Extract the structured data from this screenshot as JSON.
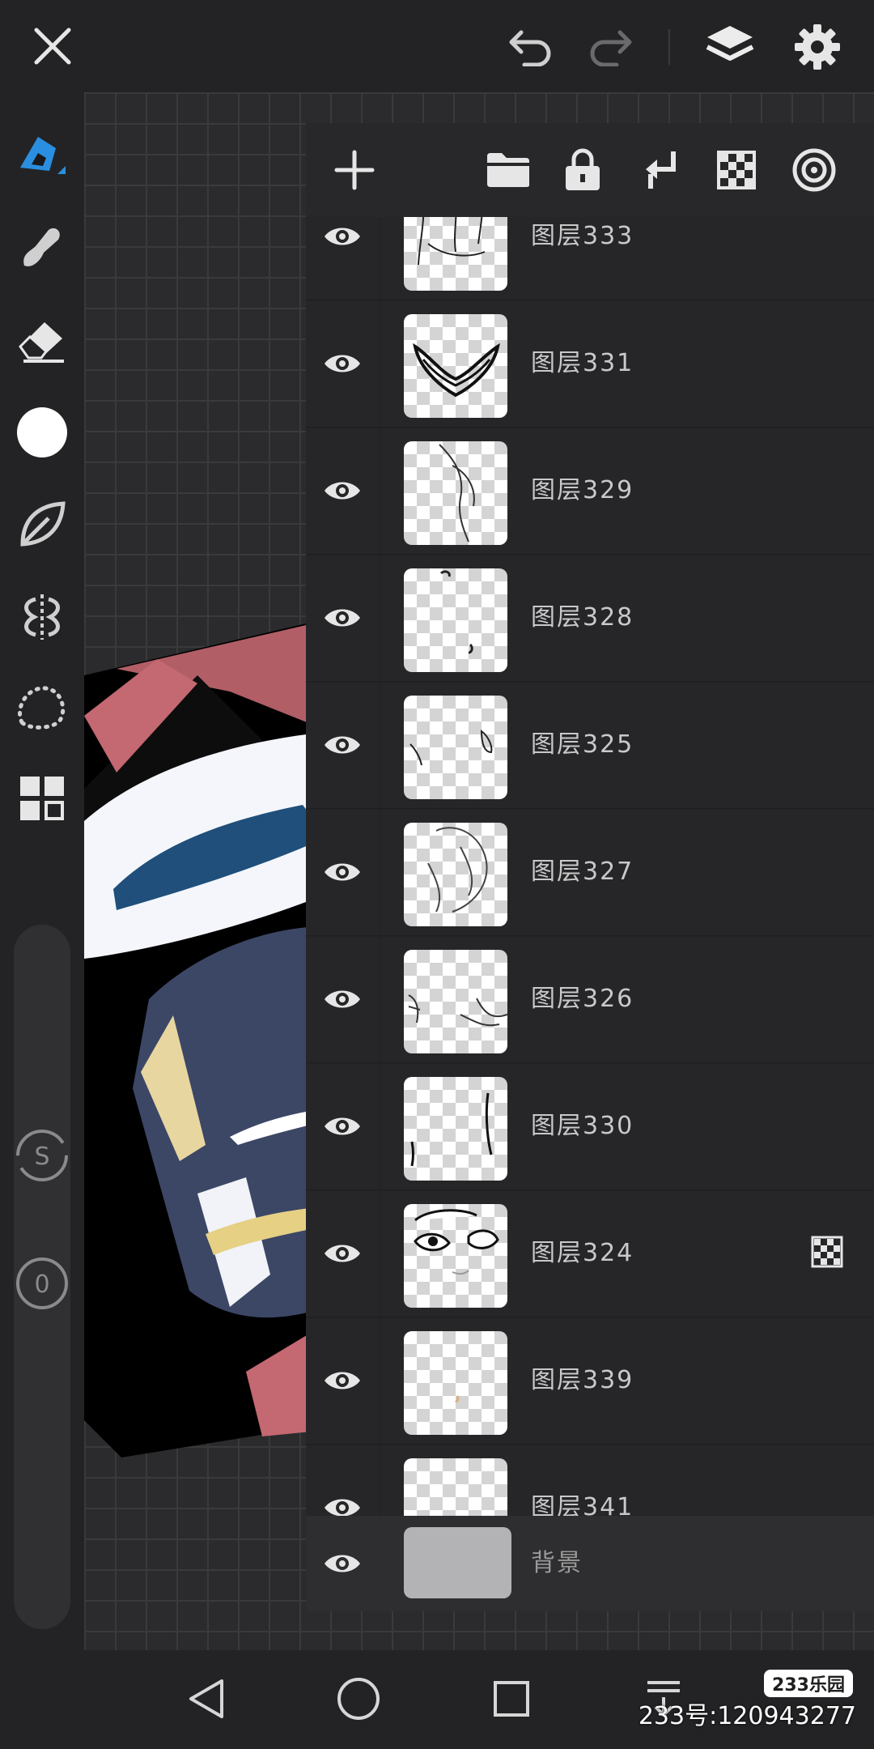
{
  "toolbar": {
    "close_icon": "close-icon",
    "undo_icon": "undo-icon",
    "redo_icon": "redo-icon",
    "layers_icon": "layers-icon",
    "settings_icon": "gear-icon"
  },
  "left_tools": [
    "pen-icon",
    "smudge-icon",
    "eraser-icon",
    "color-swatch",
    "leaf-icon",
    "symmetry-icon",
    "lasso-icon",
    "grid-icon"
  ],
  "sliders": {
    "size_label": "S",
    "opacity_label": "0"
  },
  "layers_panel": {
    "actions": [
      "add-icon",
      "folder-icon",
      "lock-icon",
      "merge-down-icon",
      "checker-icon",
      "target-icon"
    ],
    "layers": [
      {
        "name": "图层333",
        "visible": true
      },
      {
        "name": "图层331",
        "visible": true
      },
      {
        "name": "图层329",
        "visible": true
      },
      {
        "name": "图层328",
        "visible": true
      },
      {
        "name": "图层325",
        "visible": true
      },
      {
        "name": "图层327",
        "visible": true
      },
      {
        "name": "图层326",
        "visible": true
      },
      {
        "name": "图层330",
        "visible": true
      },
      {
        "name": "图层324",
        "visible": true,
        "alpha_locked": true
      },
      {
        "name": "图层339",
        "visible": true
      },
      {
        "name": "图层341",
        "visible": true
      }
    ],
    "background": {
      "name": "背景",
      "visible": true
    }
  },
  "watermark": {
    "logo": "233乐园",
    "id_text": "233号:120943277"
  },
  "colors": {
    "accent": "#2a8fe0",
    "panel": "#2a2a2c",
    "bar": "#232325"
  }
}
